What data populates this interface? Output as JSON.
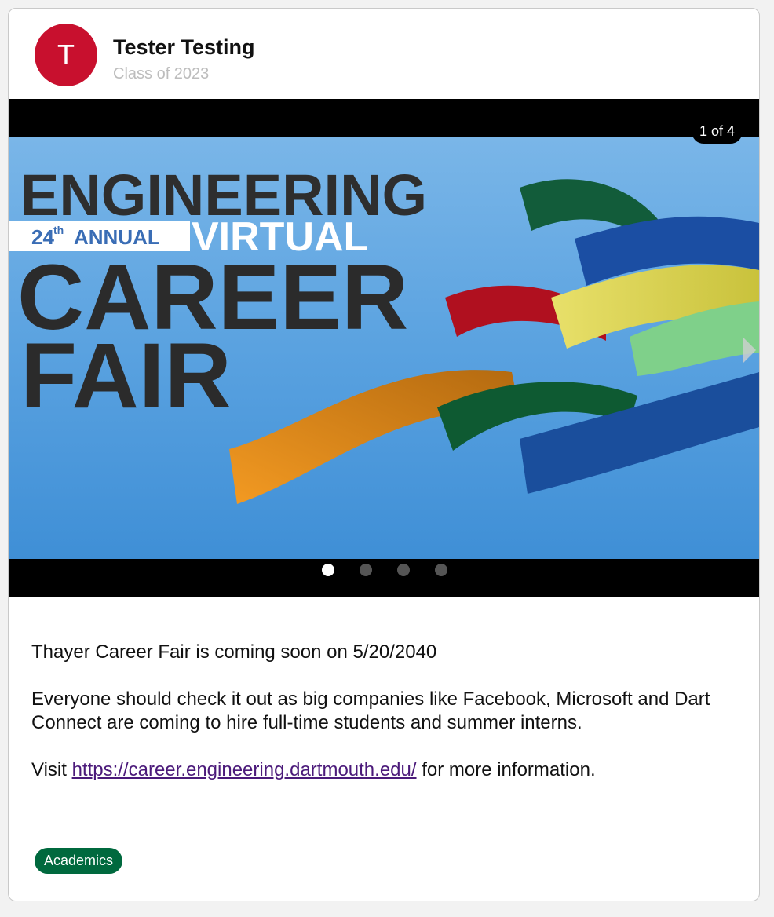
{
  "author": {
    "avatar_initial": "T",
    "name": "Tester Testing",
    "subtitle": "Class of 2023"
  },
  "carousel": {
    "counter": "1 of 4",
    "total_slides": 4,
    "active_slide": 1,
    "slide": {
      "title_line1": "ENGINEERING",
      "annual_num": "24",
      "annual_sup": "th",
      "annual_word": "ANNUAL",
      "virtual": "VIRTUAL",
      "career": "CAREER",
      "fair": "FAIR"
    }
  },
  "post": {
    "line1": "Thayer Career Fair is coming soon on 5/20/2040",
    "line2": "Everyone should check it out as big companies like Facebook, Microsoft and Dart Connect are coming to hire full-time students and summer interns.",
    "visit_prefix": "Visit",
    "link_text": "https://career.engineering.dartmouth.edu/",
    "visit_suffix": "for more information."
  },
  "tags": [
    "Academics"
  ],
  "colors": {
    "avatar": "#c8102e",
    "tag": "#00693e",
    "link": "#4b1a7a"
  }
}
